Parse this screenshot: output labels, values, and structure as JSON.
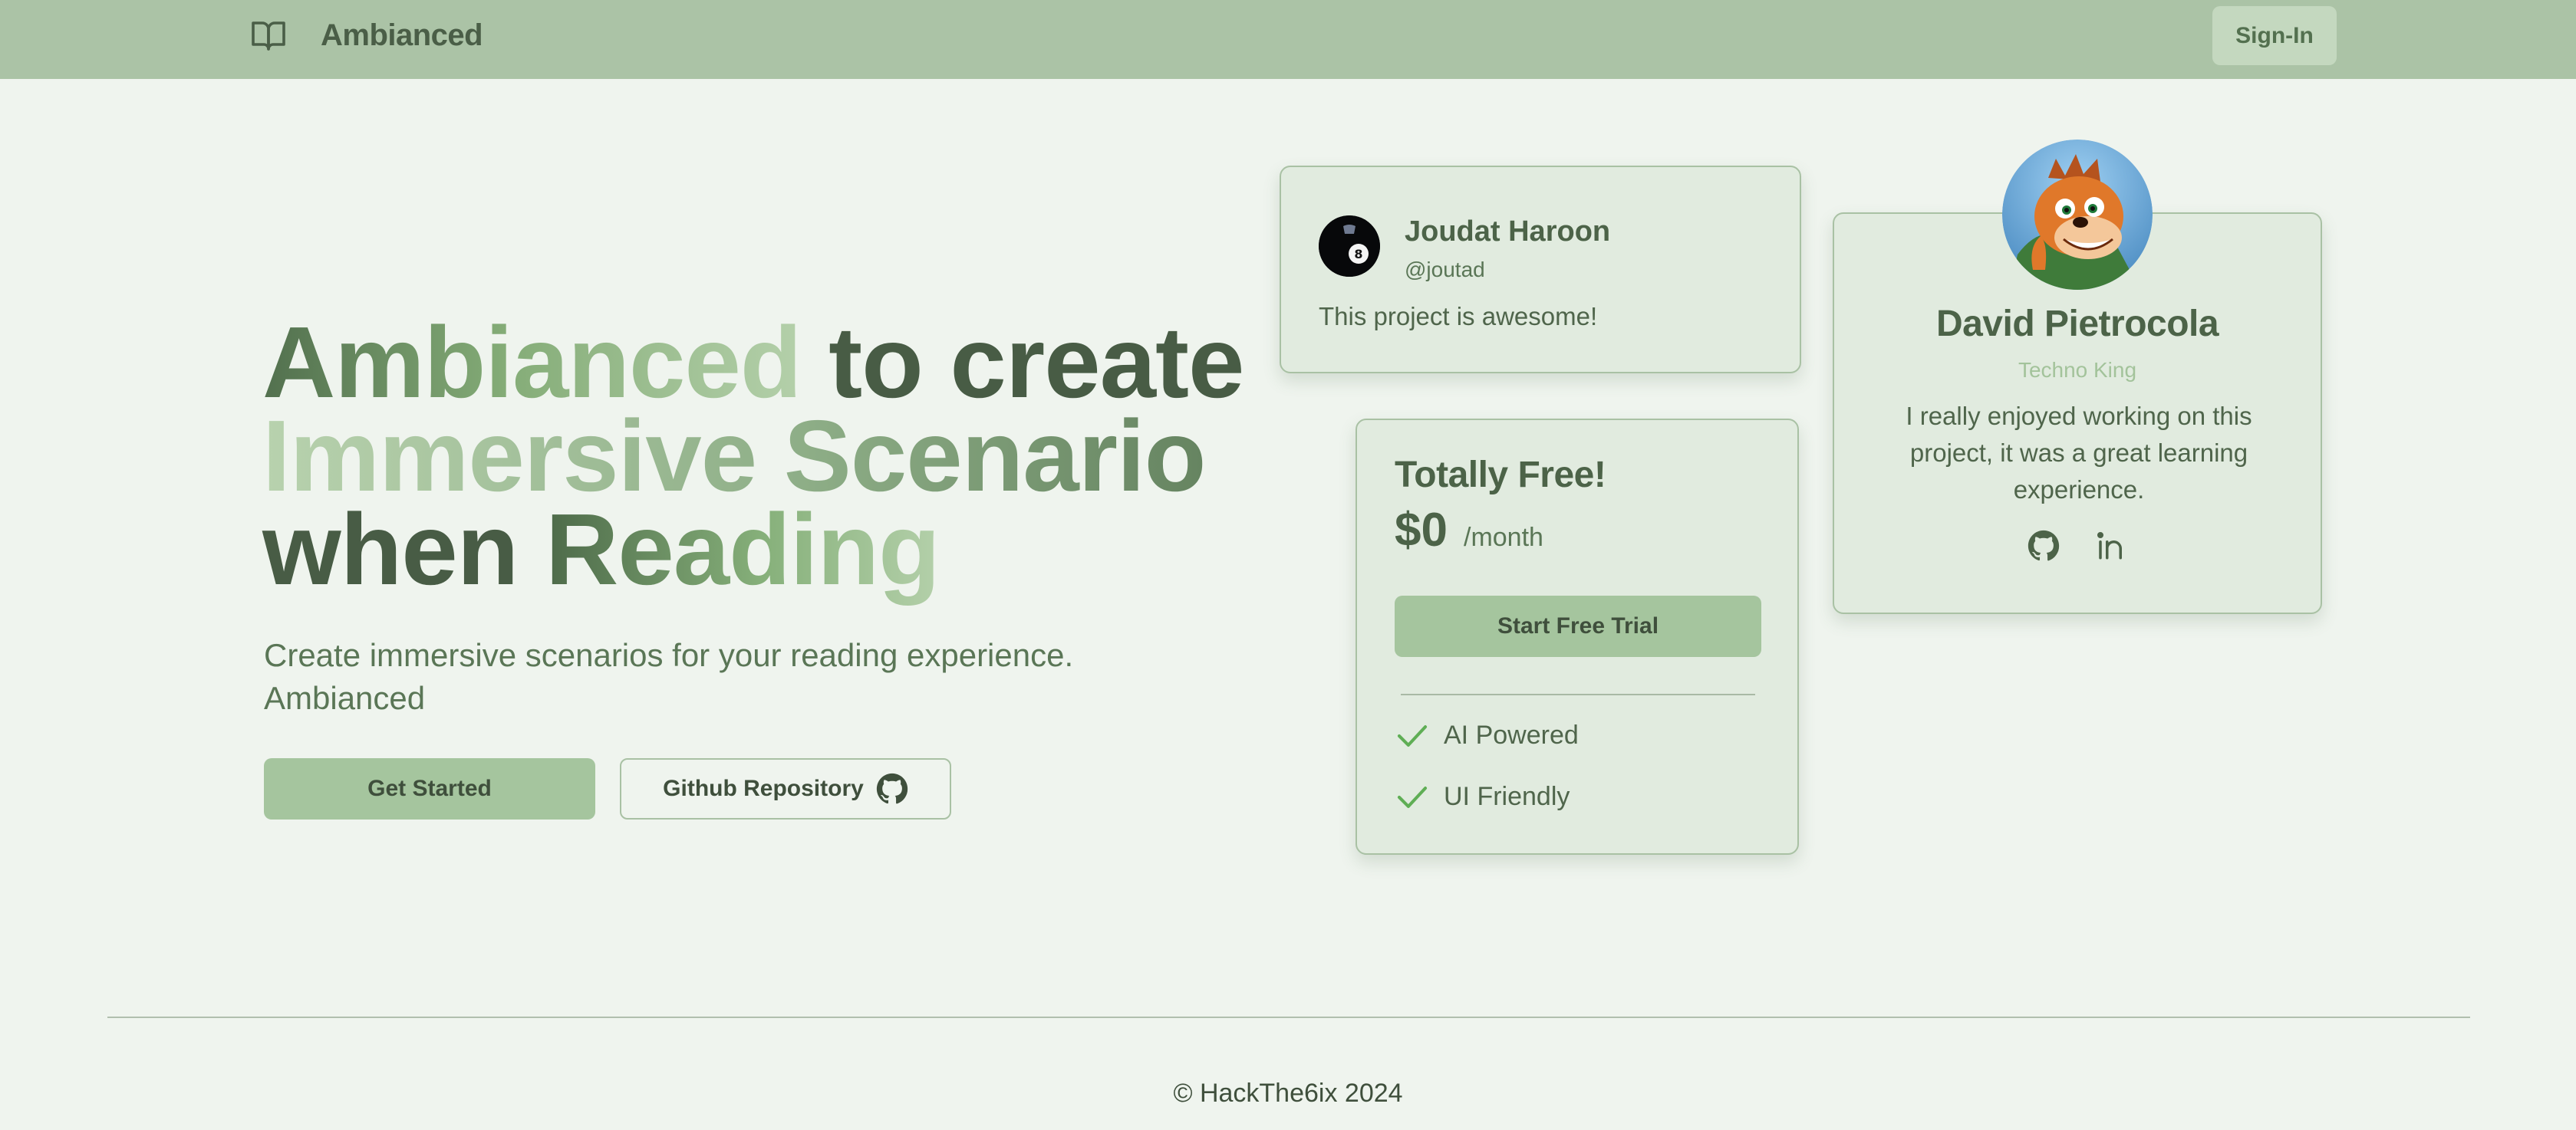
{
  "nav": {
    "brand_icon": "book-open-icon",
    "brand_name": "Ambianced",
    "signin_label": "Sign-In"
  },
  "hero": {
    "headline": {
      "line1_a": "Ambianced",
      "line1_b": " to create",
      "line2": "Immersive Scenario",
      "line3_a": "when ",
      "line3_b": "Reading"
    },
    "subtitle": "Create immersive scenarios for your reading experience. Ambianced",
    "get_started_label": "Get Started",
    "github_label": "Github Repository",
    "github_icon": "github-icon"
  },
  "testimonial": {
    "avatar_icon": "eight-ball-avatar",
    "name": "Joudat Haroon",
    "handle": "@joutad",
    "quote": "This project is awesome!"
  },
  "pricing": {
    "title": "Totally Free!",
    "price": "$0",
    "period": "/month",
    "cta_label": "Start Free Trial",
    "features": [
      {
        "label": "AI Powered",
        "icon": "check-icon"
      },
      {
        "label": "UI Friendly",
        "icon": "check-icon"
      }
    ]
  },
  "profile": {
    "avatar_icon": "cartoon-fox-avatar",
    "name": "David Pietrocola",
    "role": "Techno King",
    "bio": "I really enjoyed working on this project, it was a great learning experience.",
    "links": [
      {
        "icon": "github-icon"
      },
      {
        "icon": "linkedin-icon"
      }
    ]
  },
  "footer": {
    "text": "© HackThe6ix 2024"
  },
  "colors": {
    "background": "#eff4ee",
    "nav": "#abc3a6",
    "primary_button": "#a5c59e",
    "card": "#e1ebdf",
    "accent_check": "#5fae55"
  }
}
